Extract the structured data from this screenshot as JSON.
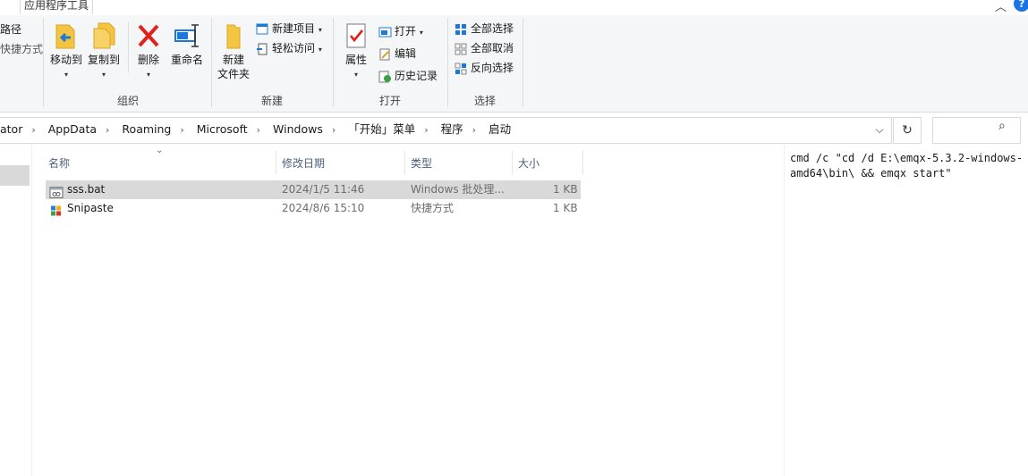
{
  "titlebar": {
    "tool_tab": "应用程序工具"
  },
  "ribbon": {
    "left_cut": {
      "item1": "路径",
      "item2": "快捷方式"
    },
    "organize": {
      "label": "组织",
      "move_to": "移动到",
      "copy_to": "复制到",
      "delete": "删除",
      "rename": "重命名"
    },
    "new": {
      "label": "新建",
      "new_folder_line1": "新建",
      "new_folder_line2": "文件夹",
      "new_item": "新建项目",
      "easy_access": "轻松访问"
    },
    "open": {
      "label": "打开",
      "properties": "属性",
      "open": "打开",
      "edit": "编辑",
      "history": "历史记录"
    },
    "select": {
      "label": "选择",
      "select_all": "全部选择",
      "select_none": "全部取消",
      "invert": "反向选择"
    }
  },
  "address": {
    "crumbs": [
      "ator",
      "AppData",
      "Roaming",
      "Microsoft",
      "Windows",
      "「开始」菜单",
      "程序",
      "启动"
    ]
  },
  "columns": {
    "name": "名称",
    "modified": "修改日期",
    "type": "类型",
    "size": "大小"
  },
  "files": [
    {
      "name": "sss.bat",
      "modified": "2024/1/5 11:46",
      "type": "Windows 批处理...",
      "size": "1 KB"
    },
    {
      "name": "Snipaste",
      "modified": "2024/8/6 15:10",
      "type": "快捷方式",
      "size": "1 KB"
    }
  ],
  "preview": {
    "text": "cmd /c \"cd /d E:\\emqx-5.3.2-windows-amd64\\bin\\ && emqx start\""
  }
}
